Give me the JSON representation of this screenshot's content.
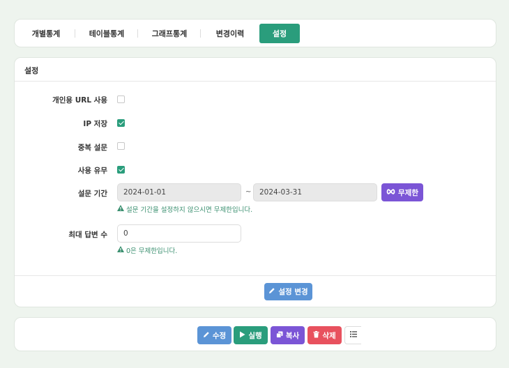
{
  "tabs": [
    {
      "label": "개별통계",
      "active": false
    },
    {
      "label": "테이블통계",
      "active": false
    },
    {
      "label": "그래프통계",
      "active": false
    },
    {
      "label": "변경이력",
      "active": false
    },
    {
      "label": "설정",
      "active": true
    }
  ],
  "settings": {
    "title": "설정",
    "personal_url_label": "개인용 URL 사용",
    "personal_url_checked": false,
    "ip_save_label": "IP 저장",
    "ip_save_checked": true,
    "duplicate_label": "중복 설문",
    "duplicate_checked": false,
    "use_label": "사용 유무",
    "use_checked": true,
    "period_label": "설문 기간",
    "period_start": "2024-01-01",
    "period_separator": "~",
    "period_end": "2024-03-31",
    "unlimited_label": "무제한",
    "period_hint": "설문 기간을 설정하지 않으시면 무제한입니다.",
    "max_answers_label": "최대 답변 수",
    "max_answers_value": "0",
    "max_answers_hint": "0은 무제한입니다.",
    "save_label": "설정 변경"
  },
  "actions": {
    "edit_label": "수정",
    "run_label": "실행",
    "copy_label": "복사",
    "delete_label": "삭제"
  },
  "colors": {
    "accent_green": "#2a9d7c",
    "purple": "#7b55d6",
    "blue": "#5b94d6",
    "red": "#e8515e"
  }
}
